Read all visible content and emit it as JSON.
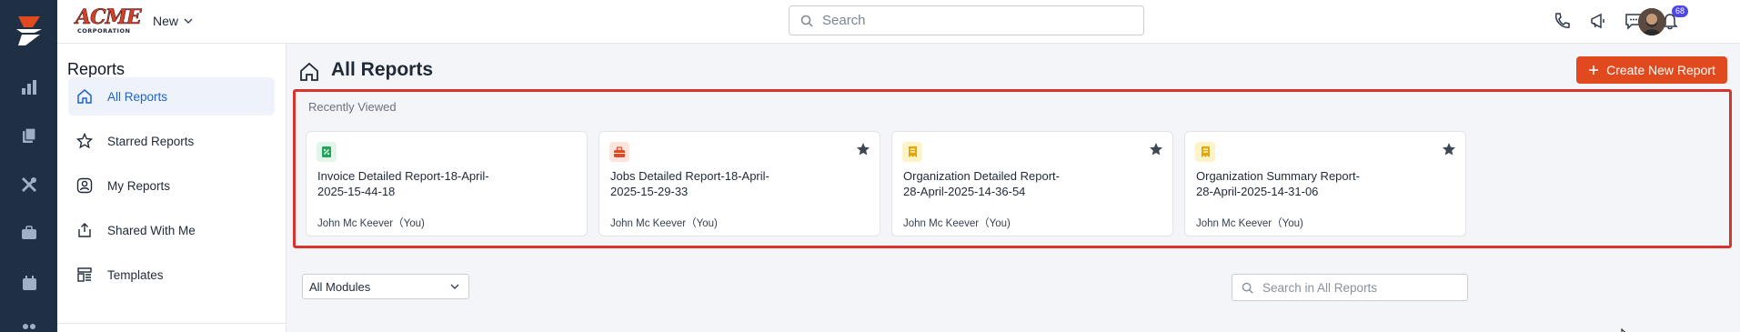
{
  "header": {
    "brand_top": "ACME",
    "brand_bottom": "CORPORATION",
    "new_label": "New",
    "search_placeholder": "Search",
    "notification_count": "68"
  },
  "rail": {
    "icons": [
      "analytics-icon",
      "clipboard-icon",
      "tools-icon",
      "briefcase-icon",
      "calendar-icon",
      "users-icon"
    ]
  },
  "sidebar": {
    "title": "Reports",
    "items": [
      {
        "label": "All Reports",
        "icon": "home-icon",
        "active": true
      },
      {
        "label": "Starred Reports",
        "icon": "star-icon"
      },
      {
        "label": "My Reports",
        "icon": "user-icon"
      },
      {
        "label": "Shared With Me",
        "icon": "share-icon"
      },
      {
        "label": "Templates",
        "icon": "template-icon"
      }
    ]
  },
  "main": {
    "title": "All Reports",
    "create_button": "Create New Report",
    "recently_viewed_label": "Recently Viewed",
    "cards": [
      {
        "title": "Invoice Detailed Report-18-April-2025-15-44-18",
        "owner": "John Mc Keever（You)",
        "icon": "invoice-icon",
        "starred": false
      },
      {
        "title": "Jobs Detailed Report-18-April-2025-15-29-33",
        "owner": "John Mc Keever（You)",
        "icon": "briefcase-icon",
        "starred": true
      },
      {
        "title": "Organization Detailed Report-28-April-2025-14-36-54",
        "owner": "John Mc Keever（You)",
        "icon": "organization-icon",
        "starred": true
      },
      {
        "title": "Organization Summary Report-28-April-2025-14-31-06",
        "owner": "John Mc Keever（You)",
        "icon": "organization-icon",
        "starred": true
      }
    ],
    "module_select": "All Modules",
    "report_search_placeholder": "Search in All Reports"
  },
  "colors": {
    "rail_bg": "#1f2f44",
    "accent_orange": "#e04a1e",
    "active_blue": "#1e63c9",
    "highlight_red": "#d9342b"
  }
}
